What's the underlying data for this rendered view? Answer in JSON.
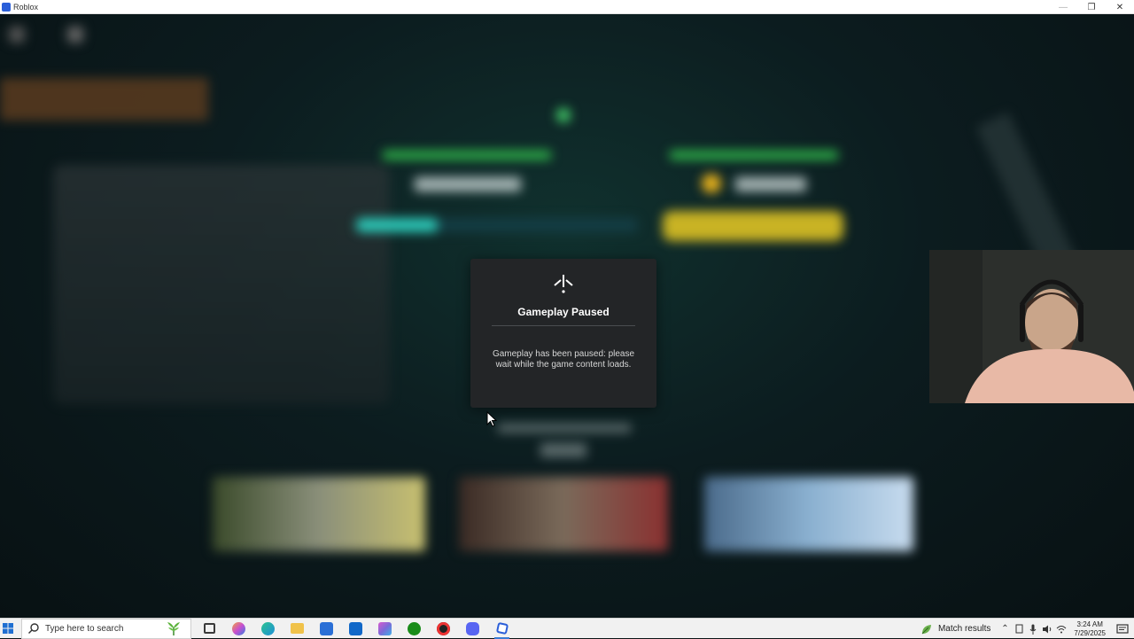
{
  "window": {
    "title": "Roblox",
    "controls": {
      "minimize": "—",
      "restore": "❐",
      "close": "✕"
    }
  },
  "modal": {
    "title": "Gameplay Paused",
    "body": "Gameplay has been paused: please wait while the game content loads."
  },
  "taskbar": {
    "search_placeholder": "Type here to search",
    "apps": [
      {
        "name": "task-view",
        "color": "#3a3a3a"
      },
      {
        "name": "copilot",
        "color": "#c94fd0"
      },
      {
        "name": "edge",
        "color": "#1f8fd8"
      },
      {
        "name": "file-explorer",
        "color": "#f0c24a"
      },
      {
        "name": "store",
        "color": "#2a6fd6"
      },
      {
        "name": "outlook",
        "color": "#1168c8"
      },
      {
        "name": "copilot-app",
        "color": "#7b6ad8"
      },
      {
        "name": "xbox",
        "color": "#198c19"
      },
      {
        "name": "obs",
        "color": "#333333"
      },
      {
        "name": "discord",
        "color": "#5865f2"
      },
      {
        "name": "roblox",
        "color": "#2b5fd9"
      }
    ],
    "weather_widget": "Match results",
    "time": "3:24 AM",
    "date": "7/29/2025"
  }
}
